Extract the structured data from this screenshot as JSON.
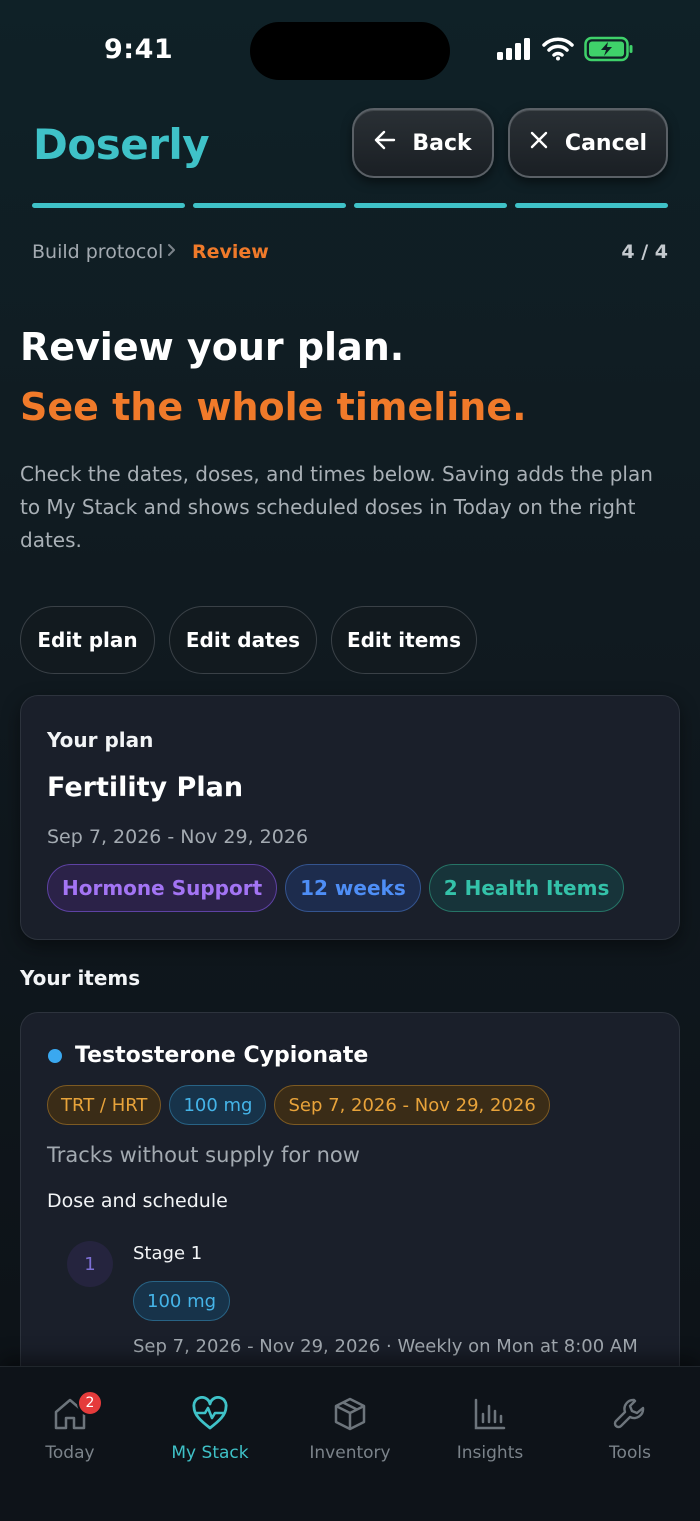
{
  "status_bar": {
    "time": "9:41"
  },
  "header": {
    "brand": "Doserly",
    "back_label": "Back",
    "cancel_label": "Cancel"
  },
  "breadcrumb": {
    "parent": "Build protocol",
    "separator": ">",
    "current": "Review",
    "step": "4 / 4"
  },
  "intro": {
    "title": "Review your plan.",
    "subtitle": "See the whole timeline.",
    "description": "Check the dates, doses, and times below. Saving adds the plan to My Stack and shows scheduled doses in Today on the right dates."
  },
  "edit_actions": {
    "edit_plan": "Edit plan",
    "edit_dates": "Edit dates",
    "edit_items": "Edit items"
  },
  "plan": {
    "label": "Your plan",
    "name": "Fertility Plan",
    "dates": "Sep 7, 2026 - Nov 29, 2026",
    "tags": {
      "category": "Hormone Support",
      "duration": "12 weeks",
      "count": "2 Health Items"
    }
  },
  "items_section": {
    "title": "Your items"
  },
  "item": {
    "name": "Testosterone Cypionate",
    "chips": {
      "category": "TRT / HRT",
      "dose": "100 mg",
      "range": "Sep 7, 2026 - Nov 29, 2026"
    },
    "note": "Tracks without supply for now",
    "schedule_title": "Dose and schedule",
    "stage": {
      "number": "1",
      "label": "Stage 1",
      "dose": "100 mg",
      "info": "Sep 7, 2026 - Nov 29, 2026 · Weekly on Mon at 8:00 AM"
    }
  },
  "tabbar": {
    "today": "Today",
    "today_badge": "2",
    "stack": "My Stack",
    "inventory": "Inventory",
    "insights": "Insights",
    "tools": "Tools"
  },
  "colors": {
    "accent_teal": "#3fc2c8",
    "accent_orange": "#f07a2a",
    "background": "#10191f"
  },
  "icons": [
    "signal-icon",
    "wifi-icon",
    "battery-icon",
    "arrow-left-icon",
    "close-icon",
    "chevron-right-icon",
    "home-icon",
    "heart-pulse-icon",
    "box-icon",
    "bar-chart-icon",
    "wrench-icon"
  ]
}
